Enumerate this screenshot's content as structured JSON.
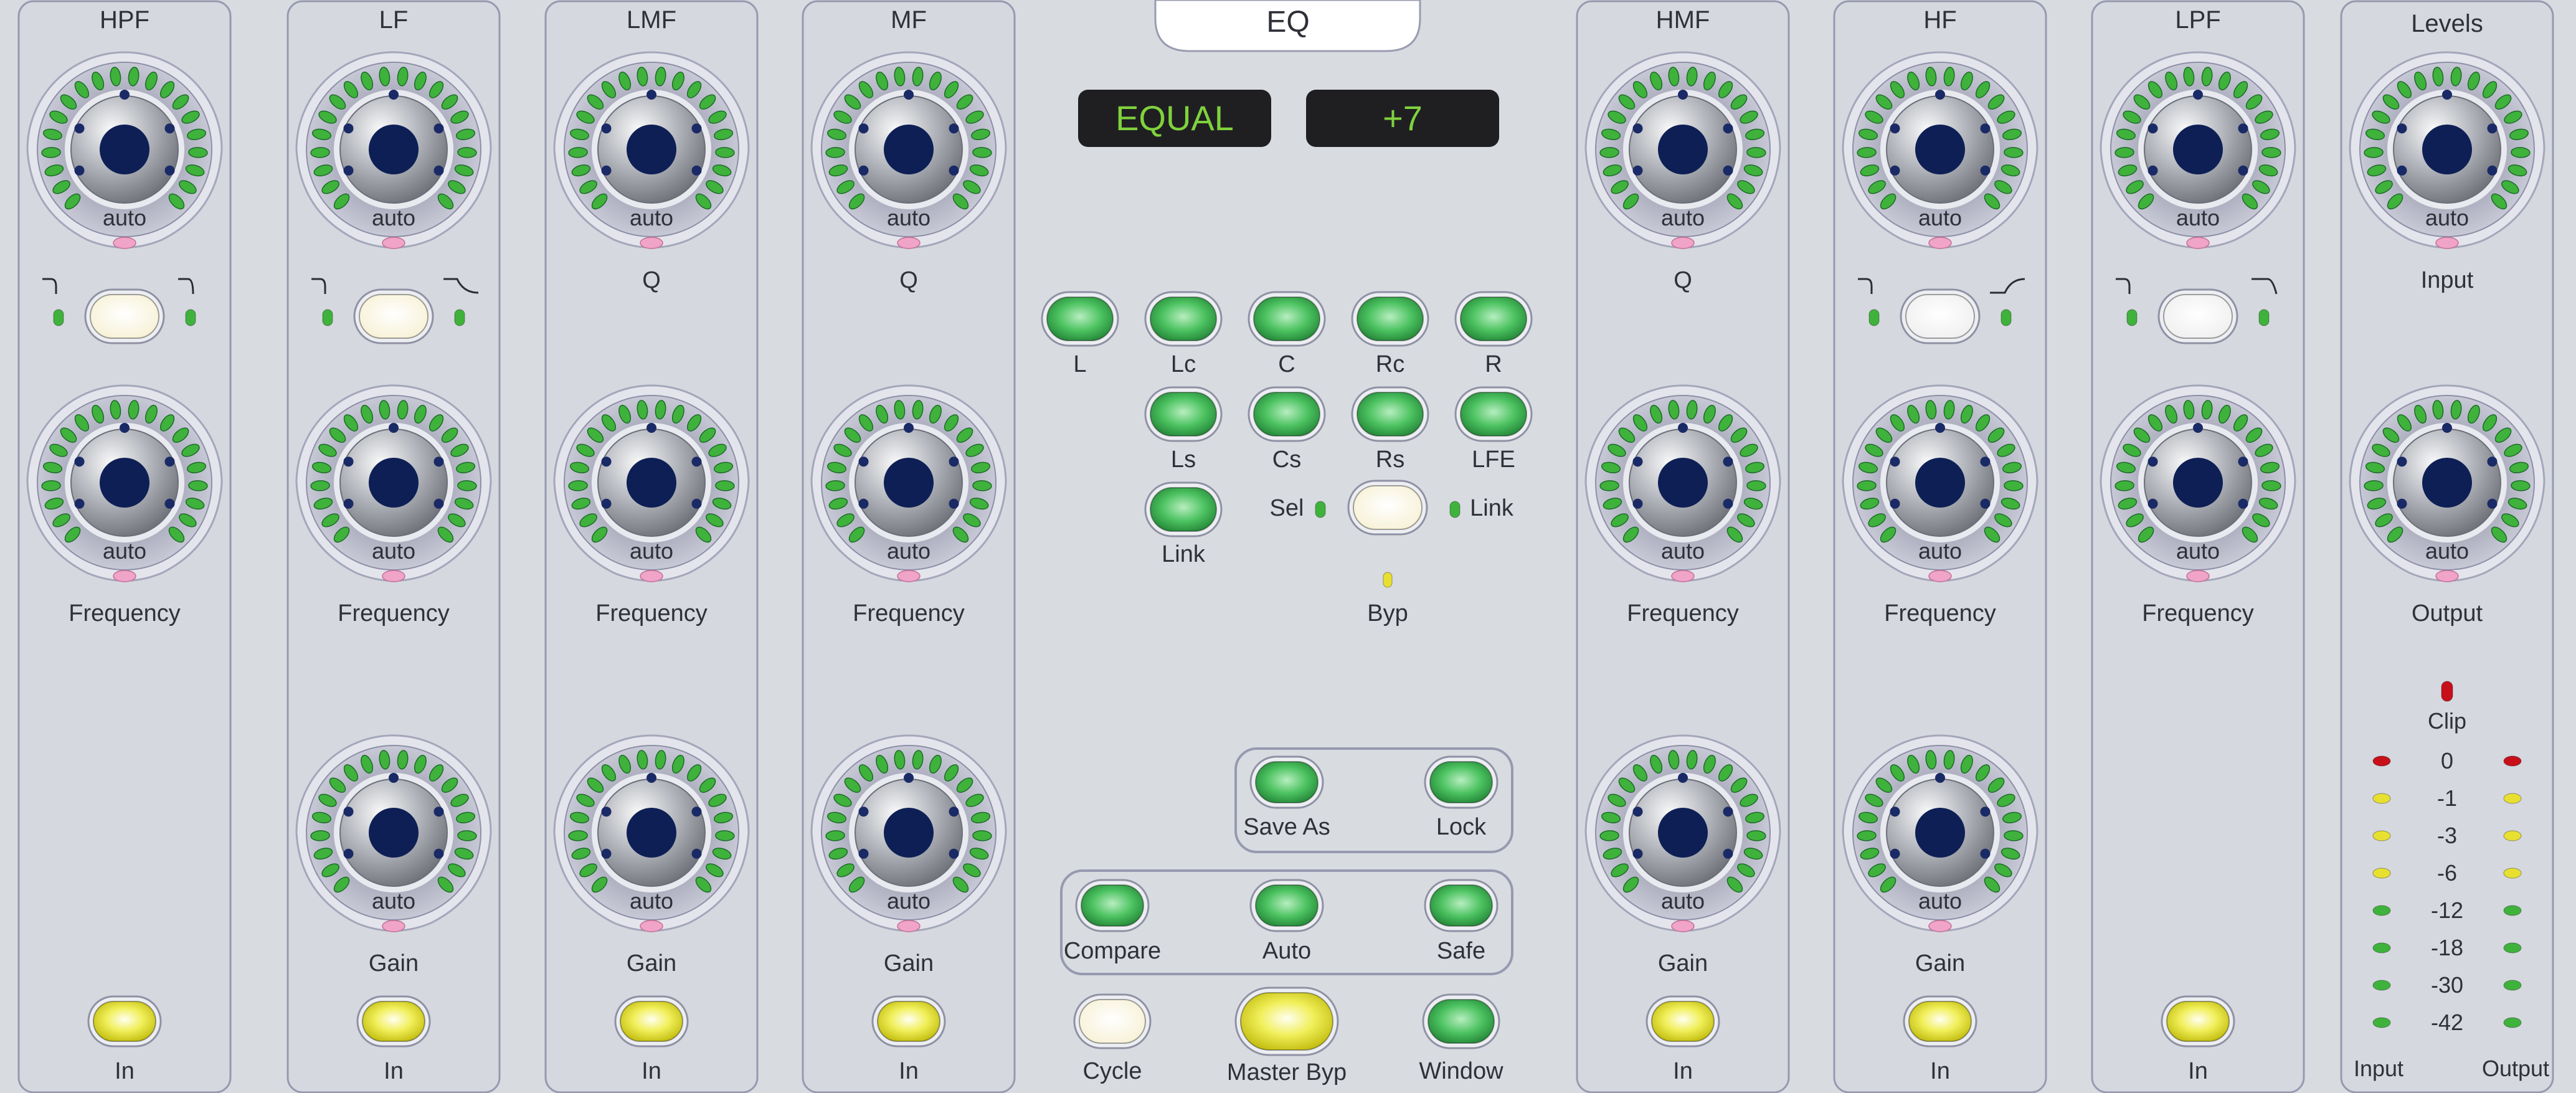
{
  "title": "EQ",
  "display": {
    "preset": "EQUAL",
    "value": "+7"
  },
  "colors": {
    "panel": "#d8dbe0",
    "display_text": "#7fd23c",
    "led_green": "#3fb23c",
    "led_yellow": "#e8e030",
    "led_red": "#c8101a"
  },
  "knob_label": "auto",
  "bands": [
    {
      "name": "HPF",
      "knob1_label": "",
      "filter_switch": true,
      "knob2_label": "Frequency",
      "knob3_label": "",
      "in_label": "In"
    },
    {
      "name": "LF",
      "knob1_label": "",
      "filter_switch": true,
      "knob2_label": "Frequency",
      "knob3_label": "Gain",
      "in_label": "In"
    },
    {
      "name": "LMF",
      "knob1_label": "Q",
      "filter_switch": false,
      "knob2_label": "Frequency",
      "knob3_label": "Gain",
      "in_label": "In"
    },
    {
      "name": "MF",
      "knob1_label": "Q",
      "filter_switch": false,
      "knob2_label": "Frequency",
      "knob3_label": "Gain",
      "in_label": "In"
    },
    {
      "name": "HMF",
      "knob1_label": "Q",
      "filter_switch": false,
      "knob2_label": "Frequency",
      "knob3_label": "Gain",
      "in_label": "In"
    },
    {
      "name": "HF",
      "knob1_label": "",
      "filter_switch": true,
      "knob2_label": "Frequency",
      "knob3_label": "Gain",
      "in_label": "In"
    },
    {
      "name": "LPF",
      "knob1_label": "",
      "filter_switch": true,
      "knob2_label": "Frequency",
      "knob3_label": "",
      "in_label": "In"
    }
  ],
  "levels": {
    "title": "Levels",
    "input_label": "Input",
    "output_label": "Output",
    "clip_label": "Clip",
    "meter_scale": [
      "0",
      "-1",
      "-3",
      "-6",
      "-12",
      "-18",
      "-30",
      "-42"
    ],
    "meter_input_label": "Input",
    "meter_output_label": "Output"
  },
  "channels": {
    "row1": [
      "L",
      "Lc",
      "C",
      "Rc",
      "R"
    ],
    "row2": [
      "Ls",
      "Cs",
      "Rs",
      "LFE"
    ],
    "link_label": "Link",
    "sel_label": "Sel",
    "sel_link_label": "Link",
    "byp_label": "Byp"
  },
  "buttons": {
    "save_as": "Save As",
    "lock": "Lock",
    "compare": "Compare",
    "auto": "Auto",
    "safe": "Safe",
    "cycle": "Cycle",
    "master_byp": "Master Byp",
    "window": "Window"
  }
}
